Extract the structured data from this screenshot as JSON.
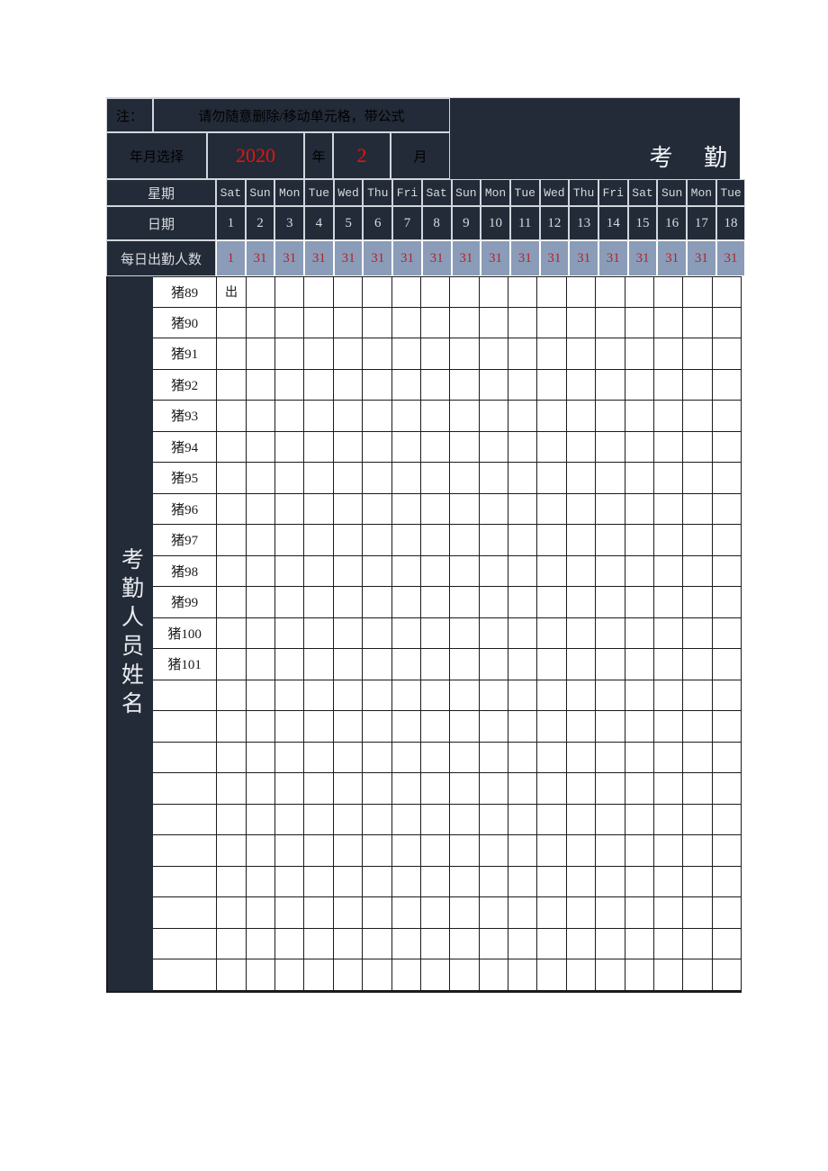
{
  "note": {
    "label": "注：",
    "text": "请勿随意删除/移动单元格，带公式"
  },
  "title": "考  勤",
  "selector": {
    "label": "年月选择",
    "year": "2020",
    "year_unit": "年",
    "month": "2",
    "month_unit": "月"
  },
  "row_labels": {
    "weekday": "星期",
    "date": "日期",
    "daily_count": "每日出勤人数",
    "side": "考勤人员姓名"
  },
  "weekdays": [
    "Sat",
    "Sun",
    "Mon",
    "Tue",
    "Wed",
    "Thu",
    "Fri",
    "Sat",
    "Sun",
    "Mon",
    "Tue",
    "Wed",
    "Thu",
    "Fri",
    "Sat",
    "Sun",
    "Mon",
    "Tue"
  ],
  "dates": [
    "1",
    "2",
    "3",
    "4",
    "5",
    "6",
    "7",
    "8",
    "9",
    "10",
    "11",
    "12",
    "13",
    "14",
    "15",
    "16",
    "17",
    "18"
  ],
  "daily_counts": [
    "1",
    "31",
    "31",
    "31",
    "31",
    "31",
    "31",
    "31",
    "31",
    "31",
    "31",
    "31",
    "31",
    "31",
    "31",
    "31",
    "31",
    "31"
  ],
  "names": [
    "猪89",
    "猪90",
    "猪91",
    "猪92",
    "猪93",
    "猪94",
    "猪95",
    "猪96",
    "猪97",
    "猪98",
    "猪99",
    "猪100",
    "猪101",
    "",
    "",
    "",
    "",
    "",
    "",
    "",
    "",
    "",
    ""
  ],
  "attendance": [
    [
      "出",
      "",
      "",
      "",
      "",
      "",
      "",
      "",
      "",
      "",
      "",
      "",
      "",
      "",
      "",
      "",
      "",
      ""
    ],
    [
      "",
      "",
      "",
      "",
      "",
      "",
      "",
      "",
      "",
      "",
      "",
      "",
      "",
      "",
      "",
      "",
      "",
      ""
    ],
    [
      "",
      "",
      "",
      "",
      "",
      "",
      "",
      "",
      "",
      "",
      "",
      "",
      "",
      "",
      "",
      "",
      "",
      ""
    ],
    [
      "",
      "",
      "",
      "",
      "",
      "",
      "",
      "",
      "",
      "",
      "",
      "",
      "",
      "",
      "",
      "",
      "",
      ""
    ],
    [
      "",
      "",
      "",
      "",
      "",
      "",
      "",
      "",
      "",
      "",
      "",
      "",
      "",
      "",
      "",
      "",
      "",
      ""
    ],
    [
      "",
      "",
      "",
      "",
      "",
      "",
      "",
      "",
      "",
      "",
      "",
      "",
      "",
      "",
      "",
      "",
      "",
      ""
    ],
    [
      "",
      "",
      "",
      "",
      "",
      "",
      "",
      "",
      "",
      "",
      "",
      "",
      "",
      "",
      "",
      "",
      "",
      ""
    ],
    [
      "",
      "",
      "",
      "",
      "",
      "",
      "",
      "",
      "",
      "",
      "",
      "",
      "",
      "",
      "",
      "",
      "",
      ""
    ],
    [
      "",
      "",
      "",
      "",
      "",
      "",
      "",
      "",
      "",
      "",
      "",
      "",
      "",
      "",
      "",
      "",
      "",
      ""
    ],
    [
      "",
      "",
      "",
      "",
      "",
      "",
      "",
      "",
      "",
      "",
      "",
      "",
      "",
      "",
      "",
      "",
      "",
      ""
    ],
    [
      "",
      "",
      "",
      "",
      "",
      "",
      "",
      "",
      "",
      "",
      "",
      "",
      "",
      "",
      "",
      "",
      "",
      ""
    ],
    [
      "",
      "",
      "",
      "",
      "",
      "",
      "",
      "",
      "",
      "",
      "",
      "",
      "",
      "",
      "",
      "",
      "",
      ""
    ],
    [
      "",
      "",
      "",
      "",
      "",
      "",
      "",
      "",
      "",
      "",
      "",
      "",
      "",
      "",
      "",
      "",
      "",
      ""
    ],
    [
      "",
      "",
      "",
      "",
      "",
      "",
      "",
      "",
      "",
      "",
      "",
      "",
      "",
      "",
      "",
      "",
      "",
      ""
    ],
    [
      "",
      "",
      "",
      "",
      "",
      "",
      "",
      "",
      "",
      "",
      "",
      "",
      "",
      "",
      "",
      "",
      "",
      ""
    ],
    [
      "",
      "",
      "",
      "",
      "",
      "",
      "",
      "",
      "",
      "",
      "",
      "",
      "",
      "",
      "",
      "",
      "",
      ""
    ],
    [
      "",
      "",
      "",
      "",
      "",
      "",
      "",
      "",
      "",
      "",
      "",
      "",
      "",
      "",
      "",
      "",
      "",
      ""
    ],
    [
      "",
      "",
      "",
      "",
      "",
      "",
      "",
      "",
      "",
      "",
      "",
      "",
      "",
      "",
      "",
      "",
      "",
      ""
    ],
    [
      "",
      "",
      "",
      "",
      "",
      "",
      "",
      "",
      "",
      "",
      "",
      "",
      "",
      "",
      "",
      "",
      "",
      ""
    ],
    [
      "",
      "",
      "",
      "",
      "",
      "",
      "",
      "",
      "",
      "",
      "",
      "",
      "",
      "",
      "",
      "",
      "",
      ""
    ],
    [
      "",
      "",
      "",
      "",
      "",
      "",
      "",
      "",
      "",
      "",
      "",
      "",
      "",
      "",
      "",
      "",
      "",
      ""
    ],
    [
      "",
      "",
      "",
      "",
      "",
      "",
      "",
      "",
      "",
      "",
      "",
      "",
      "",
      "",
      "",
      "",
      "",
      ""
    ],
    [
      "",
      "",
      "",
      "",
      "",
      "",
      "",
      "",
      "",
      "",
      "",
      "",
      "",
      "",
      "",
      "",
      "",
      ""
    ]
  ],
  "colors": {
    "dark_navy": "#232b38",
    "steel_blue": "#8a9cb8",
    "accent_red": "#e8120e",
    "count_red": "#b4232a",
    "grid_light": "#d2d6dd",
    "grid_dark": "#1b1b1b"
  }
}
